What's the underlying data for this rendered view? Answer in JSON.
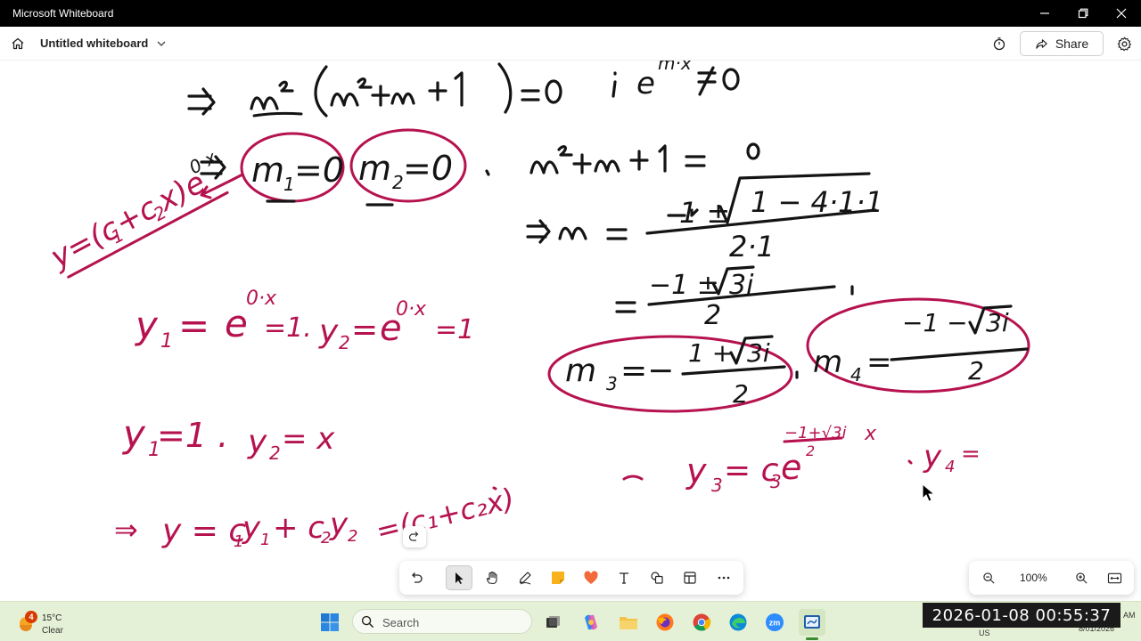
{
  "window": {
    "title": "Microsoft Whiteboard"
  },
  "header": {
    "board_title": "Untitled whiteboard",
    "share_label": "Share"
  },
  "toolbar": {
    "tools": [
      "select-icon",
      "hand-icon",
      "pen-icon",
      "sticky-note-icon",
      "reaction-icon",
      "text-icon",
      "shapes-icon",
      "template-icon",
      "more-icon"
    ],
    "active_tool": "select"
  },
  "zoom": {
    "level": "100%"
  },
  "taskbar": {
    "weather_temp": "15°C",
    "weather_condition": "Clear",
    "weather_badge": "4",
    "search_placeholder": "Search",
    "tray_lang": "US",
    "tray_time": "AM",
    "tray_date": "8/01/2026",
    "clock_overlay": "2026-01-08  00:55:37"
  },
  "whiteboard_ink": {
    "line1": "⇒ m²(m²+m+1)=0  i e^{mx} ≠ 0",
    "m1": "m1=0",
    "m2": "m2=0",
    "quadratic": "m²+m+1=0",
    "formula": "⇒ m = (−1 ± √(1−4·1·1)) / 2·1",
    "simplified": "= (−1 ± √3 i) / 2",
    "m3": "m3 = (−1+√3 i)/2",
    "m4": "m4 = (−1−√3 i)/2",
    "general_y": "y=(c1+c2x)e^{0·x}",
    "y1y2": "y1 = e^{0·x} = 1, y2 = e^{0·x} = 1",
    "y1y2_b": "y1 = 1, y2 = x",
    "y_combo": "⇒ y = c1y1 + c2y2 = (c1+c2x)",
    "y3": "y3 = c3 e^{(−1+√3i)/2 x}",
    "y4": "y4 ="
  },
  "colors": {
    "ink_black": "#141414",
    "ink_red": "#b5124f",
    "taskbar": "#e5f1d6"
  }
}
